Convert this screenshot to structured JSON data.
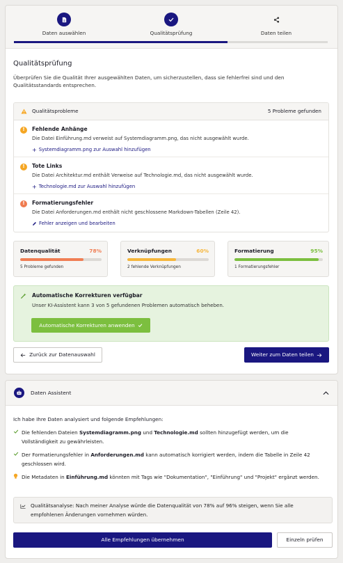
{
  "stepper": {
    "steps": [
      {
        "label": "Daten auswählen",
        "icon": "document-icon",
        "state": "done"
      },
      {
        "label": "Qualitätsprüfung",
        "icon": "check-icon",
        "state": "active"
      },
      {
        "label": "Daten teilen",
        "icon": "share-icon",
        "state": "upcoming"
      }
    ]
  },
  "page": {
    "title": "Qualitätsprüfung",
    "description": "Überprüfen Sie die Qualität Ihrer ausgewählten Daten, um sicherzustellen, dass sie fehlerfrei sind und den Qualitätsstandards entsprechen."
  },
  "issues": {
    "title": "Qualitätsprobleme",
    "count_text": "5 Probleme gefunden",
    "items": [
      {
        "title": "Fehlende Anhänge",
        "description": "Die Datei Einführung.md verweist auf Systemdiagramm.png, das nicht ausgewählt wurde.",
        "action": "Systemdiagramm.png zur Auswahl hinzufügen",
        "action_icon": "plus-icon",
        "severity_color": "#f5a623"
      },
      {
        "title": "Tote Links",
        "description": "Die Datei Architektur.md enthält Verweise auf Technologie.md, das nicht ausgewählt wurde.",
        "action": "Technologie.md zur Auswahl hinzufügen",
        "action_icon": "plus-icon",
        "severity_color": "#f5a623"
      },
      {
        "title": "Formatierungsfehler",
        "description": "Die Datei Anforderungen.md enthält nicht geschlossene Markdown-Tabellen (Zeile 42).",
        "action": "Fehler anzeigen und bearbeiten",
        "action_icon": "pencil-icon",
        "severity_color": "#ef7b4f"
      }
    ]
  },
  "metrics": [
    {
      "name": "Datenqualität",
      "percent_text": "78%",
      "value": 78,
      "subtitle": "5 Probleme gefunden",
      "color": "#f07e54"
    },
    {
      "name": "Verknüpfungen",
      "percent_text": "60%",
      "value": 60,
      "subtitle": "2 fehlende Verknüpfungen",
      "color": "#f6b63c"
    },
    {
      "name": "Formatierung",
      "percent_text": "95%",
      "value": 95,
      "subtitle": "1 Formatierungsfehler",
      "color": "#7cbf3f"
    }
  ],
  "autofix": {
    "title": "Automatische Korrekturen verfügbar",
    "description": "Unser KI-Assistent kann 3 von 5 gefundenen Problemen automatisch beheben.",
    "button": "Automatische Korrekturen anwenden"
  },
  "navigation": {
    "back": "Zurück zur Datenauswahl",
    "next": "Weiter zum Daten teilen"
  },
  "assistant": {
    "title": "Daten Assistent",
    "intro": "Ich habe Ihre Daten analysiert und folgende Empfehlungen:",
    "recommendations": [
      {
        "type": "check",
        "pre": "Die fehlenden Dateien ",
        "b1": "Systemdiagramm.png",
        "mid": " und ",
        "b2": "Technologie.md",
        "post": " sollten hinzugefügt werden, um die Vollständigkeit zu gewährleisten."
      },
      {
        "type": "check",
        "pre": "Der Formatierungsfehler in ",
        "b1": "Anforderungen.md",
        "mid": "",
        "b2": "",
        "post": " kann automatisch korrigiert werden, indem die Tabelle in Zeile 42 geschlossen wird."
      },
      {
        "type": "bulb",
        "pre": "Die Metadaten in ",
        "b1": "Einführung.md",
        "mid": "",
        "b2": "",
        "post": " könnten mit Tags wie \"Dokumentation\", \"Einführung\" und \"Projekt\" ergänzt werden."
      }
    ],
    "analysis": "Qualitätsanalyse: Nach meiner Analyse würde die Datenqualität von 78% auf 96% steigen, wenn Sie alle empfohlenen Änderungen vornehmen würden.",
    "apply_all": "Alle Empfehlungen übernehmen",
    "single": "Einzeln prüfen"
  },
  "colors": {
    "primary": "#1a1780",
    "success": "#7cbf3f",
    "warning": "#f5a623"
  }
}
